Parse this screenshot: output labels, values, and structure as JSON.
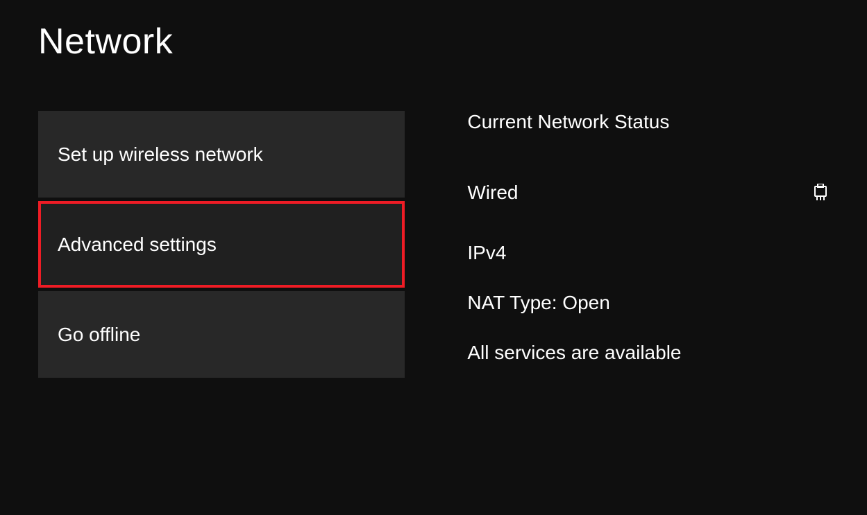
{
  "title": "Network",
  "menu": {
    "items": [
      {
        "label": "Set up wireless network",
        "selected": false
      },
      {
        "label": "Advanced settings",
        "selected": true
      },
      {
        "label": "Go offline",
        "selected": false
      }
    ]
  },
  "status": {
    "heading": "Current Network Status",
    "connection_type": "Wired",
    "ip_version": "IPv4",
    "nat": "NAT Type: Open",
    "services": "All services are available",
    "icon": "ethernet-icon"
  },
  "colors": {
    "highlight": "#ee1c25",
    "tile": "#282828",
    "tile_selected": "#202020",
    "bg": "#0f0f0f"
  }
}
